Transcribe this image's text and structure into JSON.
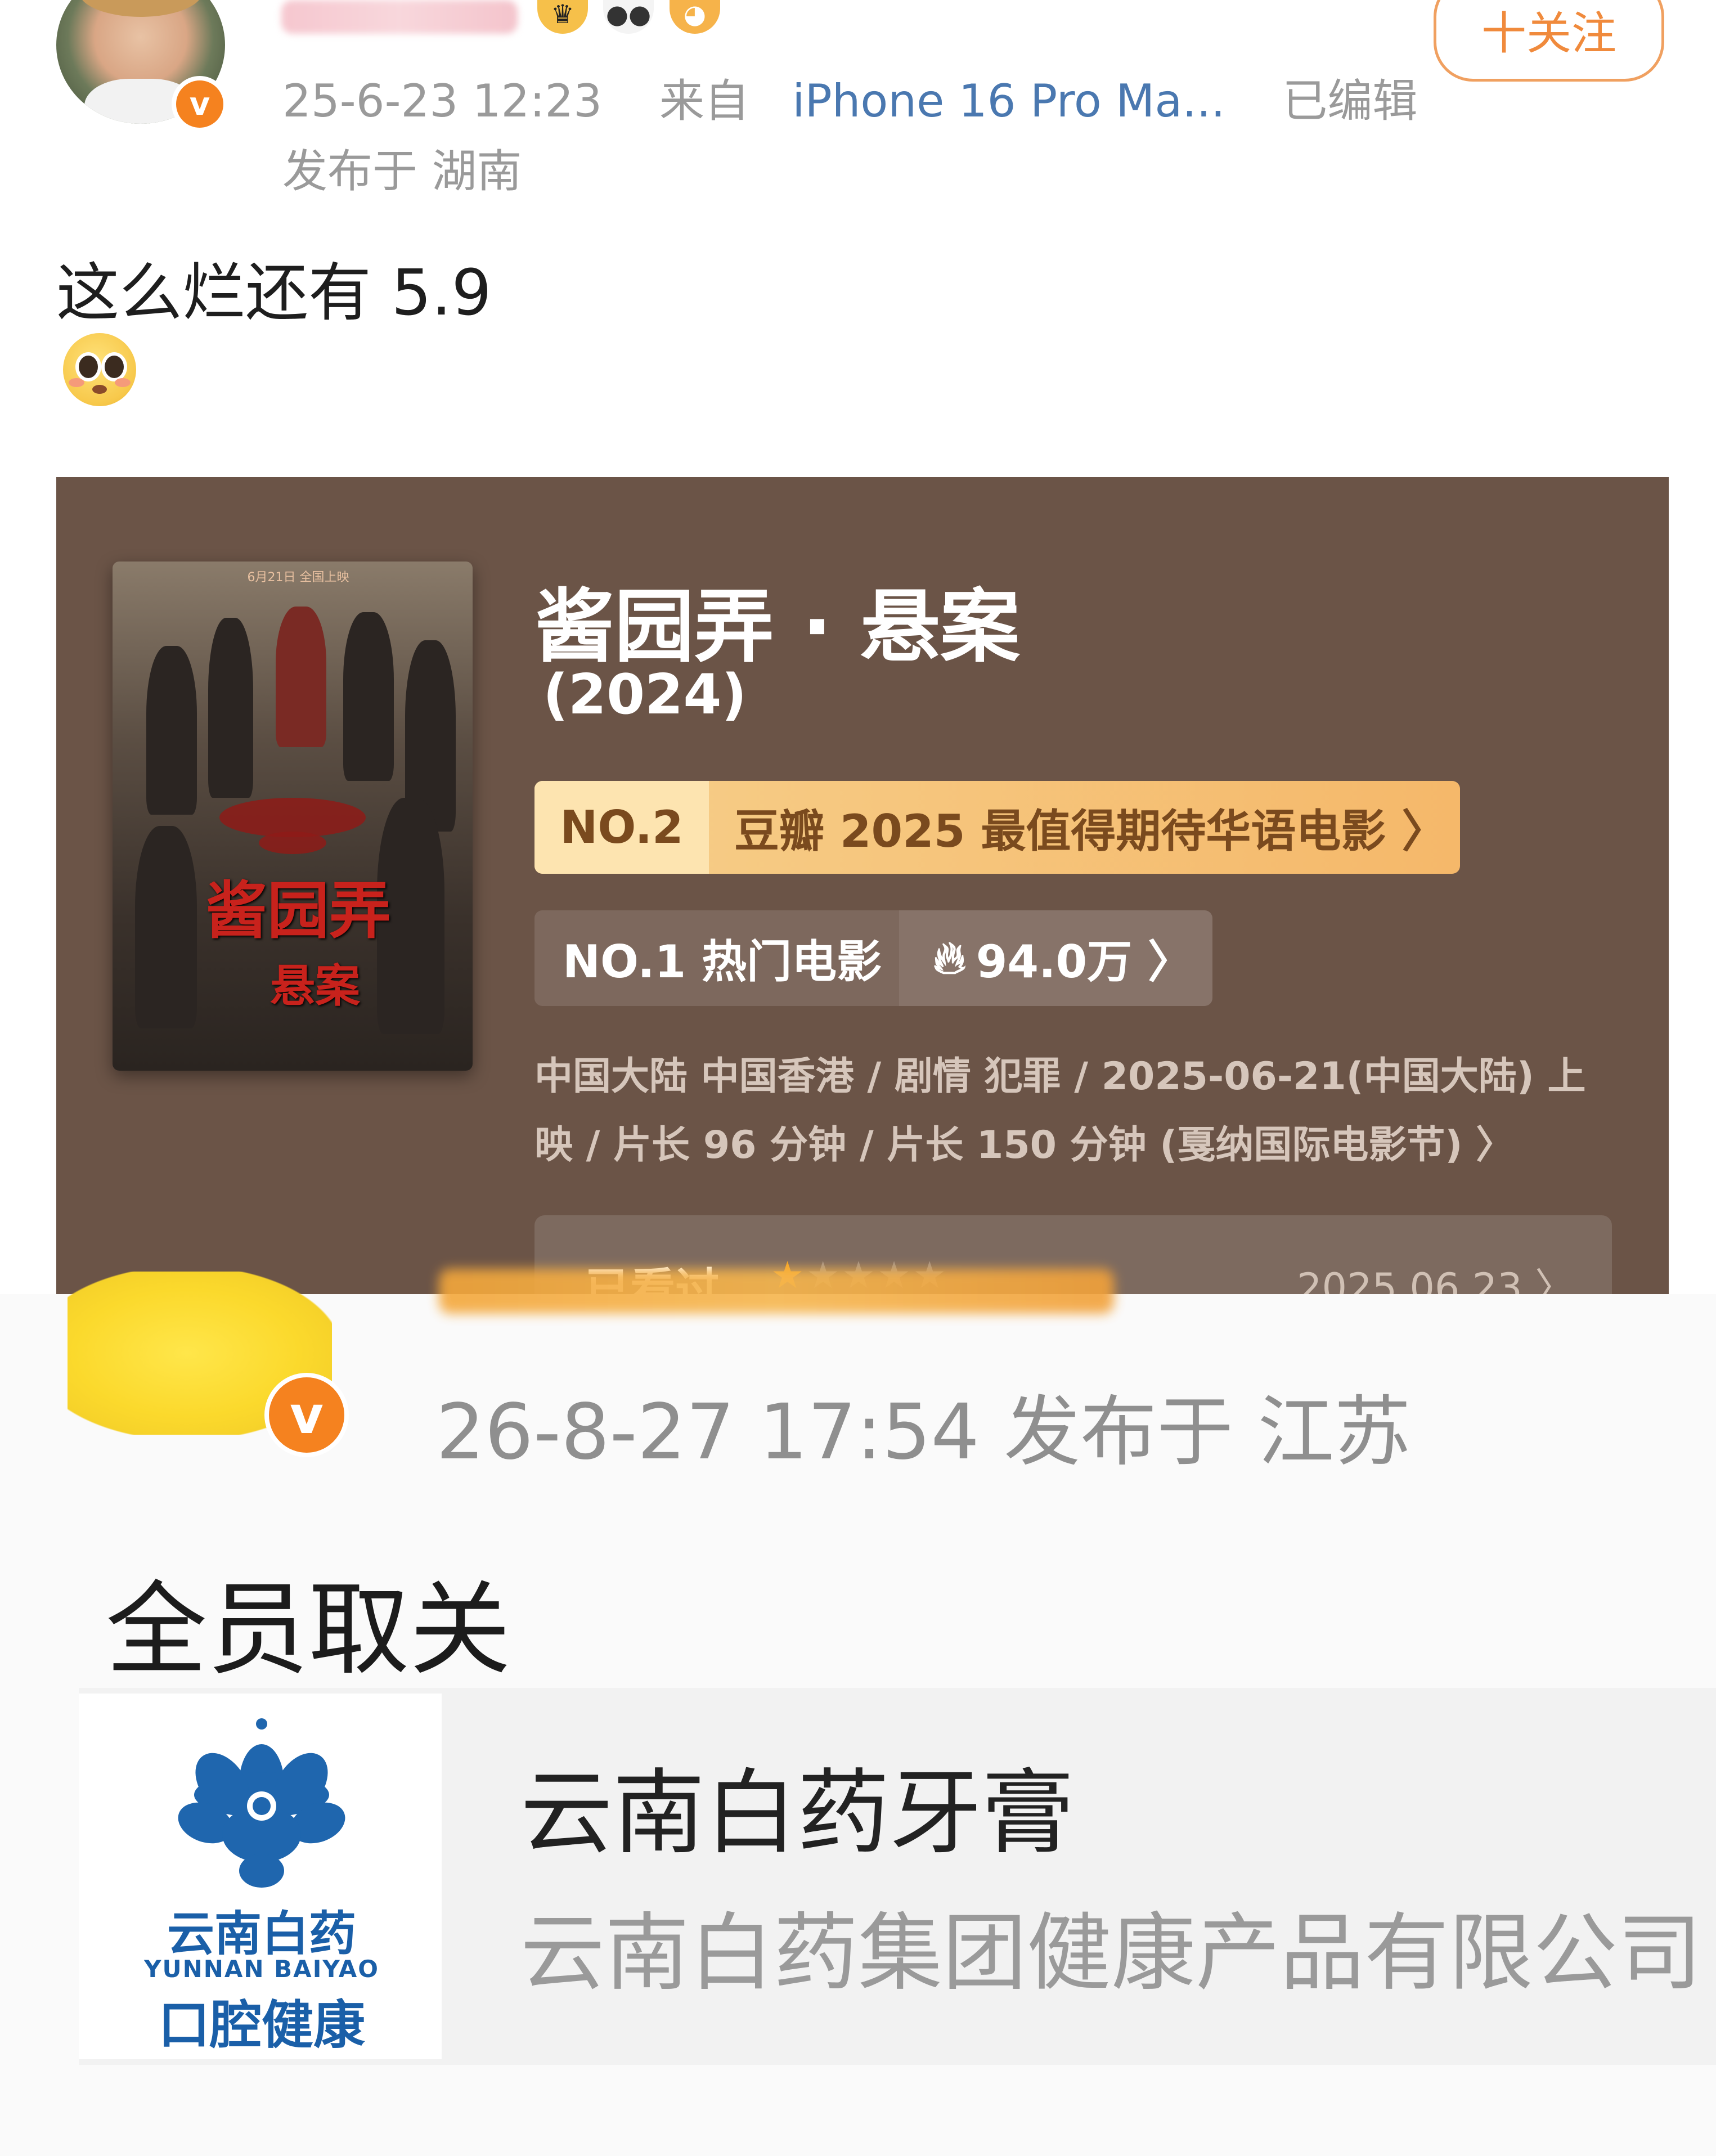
{
  "post1": {
    "timestamp": "25-6-23 12:23",
    "source_prefix": "来自",
    "source_device": "iPhone 16 Pro Ma...",
    "edited": "已编辑",
    "location": "发布于 湖南",
    "follow_button": "十关注",
    "verified_badge": "v",
    "text": "这么烂还有 5.9",
    "emoji": "flushed-face-icon"
  },
  "movie_card": {
    "title": "酱园弄 · 悬案",
    "year": "(2024)",
    "poster": {
      "top_text": "6月21日 全国上映",
      "title": "酱园弄",
      "subtitle": "悬案"
    },
    "rank1": {
      "number": "NO.2",
      "label": "豆瓣 2025 最值得期待华语电影 〉"
    },
    "rank2": {
      "number": "NO.1 热门电影",
      "heat": "94.0万 〉"
    },
    "info_line1": "中国大陆 中国香港 / 剧情 犯罪 / 2025-06-21(中国大陆) 上",
    "info_line2": "映 / 片长 96 分钟 / 片长 150 分钟 (戛纳国际电影节) 〉",
    "seen": {
      "label": "已看过",
      "rating_stars": 1,
      "max_stars": 5,
      "date": "2025.06.23 〉"
    }
  },
  "post2": {
    "verified_badge": "v",
    "meta": "26-8-27 17:54   发布于 江苏",
    "text": "全员取关"
  },
  "ad_card": {
    "title": "云南白药牙膏",
    "subtitle": "云南白药集团健康产品有限公司",
    "logo_cn": "云南白药",
    "logo_en": "YUNNAN BAIYAO",
    "logo_sub": "口腔健康"
  },
  "colors": {
    "card_bg": "#6b5447",
    "rank_gold": "#f5b86a",
    "follow_orange": "#f08a3c",
    "verify_orange": "#f5821f",
    "link_blue": "#4a78b0",
    "logo_blue": "#1a5fa8"
  }
}
